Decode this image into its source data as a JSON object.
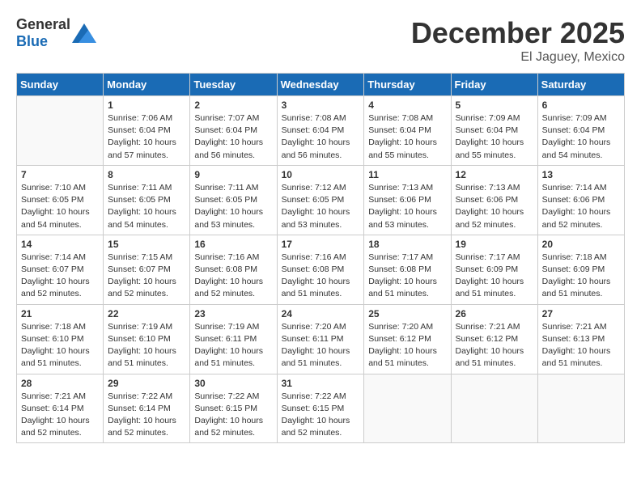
{
  "header": {
    "logo_general": "General",
    "logo_blue": "Blue",
    "month": "December 2025",
    "location": "El Jaguey, Mexico"
  },
  "days_of_week": [
    "Sunday",
    "Monday",
    "Tuesday",
    "Wednesday",
    "Thursday",
    "Friday",
    "Saturday"
  ],
  "weeks": [
    [
      {
        "day": "",
        "sunrise": "",
        "sunset": "",
        "daylight": ""
      },
      {
        "day": "1",
        "sunrise": "Sunrise: 7:06 AM",
        "sunset": "Sunset: 6:04 PM",
        "daylight": "Daylight: 10 hours and 57 minutes."
      },
      {
        "day": "2",
        "sunrise": "Sunrise: 7:07 AM",
        "sunset": "Sunset: 6:04 PM",
        "daylight": "Daylight: 10 hours and 56 minutes."
      },
      {
        "day": "3",
        "sunrise": "Sunrise: 7:08 AM",
        "sunset": "Sunset: 6:04 PM",
        "daylight": "Daylight: 10 hours and 56 minutes."
      },
      {
        "day": "4",
        "sunrise": "Sunrise: 7:08 AM",
        "sunset": "Sunset: 6:04 PM",
        "daylight": "Daylight: 10 hours and 55 minutes."
      },
      {
        "day": "5",
        "sunrise": "Sunrise: 7:09 AM",
        "sunset": "Sunset: 6:04 PM",
        "daylight": "Daylight: 10 hours and 55 minutes."
      },
      {
        "day": "6",
        "sunrise": "Sunrise: 7:09 AM",
        "sunset": "Sunset: 6:04 PM",
        "daylight": "Daylight: 10 hours and 54 minutes."
      }
    ],
    [
      {
        "day": "7",
        "sunrise": "Sunrise: 7:10 AM",
        "sunset": "Sunset: 6:05 PM",
        "daylight": "Daylight: 10 hours and 54 minutes."
      },
      {
        "day": "8",
        "sunrise": "Sunrise: 7:11 AM",
        "sunset": "Sunset: 6:05 PM",
        "daylight": "Daylight: 10 hours and 54 minutes."
      },
      {
        "day": "9",
        "sunrise": "Sunrise: 7:11 AM",
        "sunset": "Sunset: 6:05 PM",
        "daylight": "Daylight: 10 hours and 53 minutes."
      },
      {
        "day": "10",
        "sunrise": "Sunrise: 7:12 AM",
        "sunset": "Sunset: 6:05 PM",
        "daylight": "Daylight: 10 hours and 53 minutes."
      },
      {
        "day": "11",
        "sunrise": "Sunrise: 7:13 AM",
        "sunset": "Sunset: 6:06 PM",
        "daylight": "Daylight: 10 hours and 53 minutes."
      },
      {
        "day": "12",
        "sunrise": "Sunrise: 7:13 AM",
        "sunset": "Sunset: 6:06 PM",
        "daylight": "Daylight: 10 hours and 52 minutes."
      },
      {
        "day": "13",
        "sunrise": "Sunrise: 7:14 AM",
        "sunset": "Sunset: 6:06 PM",
        "daylight": "Daylight: 10 hours and 52 minutes."
      }
    ],
    [
      {
        "day": "14",
        "sunrise": "Sunrise: 7:14 AM",
        "sunset": "Sunset: 6:07 PM",
        "daylight": "Daylight: 10 hours and 52 minutes."
      },
      {
        "day": "15",
        "sunrise": "Sunrise: 7:15 AM",
        "sunset": "Sunset: 6:07 PM",
        "daylight": "Daylight: 10 hours and 52 minutes."
      },
      {
        "day": "16",
        "sunrise": "Sunrise: 7:16 AM",
        "sunset": "Sunset: 6:08 PM",
        "daylight": "Daylight: 10 hours and 52 minutes."
      },
      {
        "day": "17",
        "sunrise": "Sunrise: 7:16 AM",
        "sunset": "Sunset: 6:08 PM",
        "daylight": "Daylight: 10 hours and 51 minutes."
      },
      {
        "day": "18",
        "sunrise": "Sunrise: 7:17 AM",
        "sunset": "Sunset: 6:08 PM",
        "daylight": "Daylight: 10 hours and 51 minutes."
      },
      {
        "day": "19",
        "sunrise": "Sunrise: 7:17 AM",
        "sunset": "Sunset: 6:09 PM",
        "daylight": "Daylight: 10 hours and 51 minutes."
      },
      {
        "day": "20",
        "sunrise": "Sunrise: 7:18 AM",
        "sunset": "Sunset: 6:09 PM",
        "daylight": "Daylight: 10 hours and 51 minutes."
      }
    ],
    [
      {
        "day": "21",
        "sunrise": "Sunrise: 7:18 AM",
        "sunset": "Sunset: 6:10 PM",
        "daylight": "Daylight: 10 hours and 51 minutes."
      },
      {
        "day": "22",
        "sunrise": "Sunrise: 7:19 AM",
        "sunset": "Sunset: 6:10 PM",
        "daylight": "Daylight: 10 hours and 51 minutes."
      },
      {
        "day": "23",
        "sunrise": "Sunrise: 7:19 AM",
        "sunset": "Sunset: 6:11 PM",
        "daylight": "Daylight: 10 hours and 51 minutes."
      },
      {
        "day": "24",
        "sunrise": "Sunrise: 7:20 AM",
        "sunset": "Sunset: 6:11 PM",
        "daylight": "Daylight: 10 hours and 51 minutes."
      },
      {
        "day": "25",
        "sunrise": "Sunrise: 7:20 AM",
        "sunset": "Sunset: 6:12 PM",
        "daylight": "Daylight: 10 hours and 51 minutes."
      },
      {
        "day": "26",
        "sunrise": "Sunrise: 7:21 AM",
        "sunset": "Sunset: 6:12 PM",
        "daylight": "Daylight: 10 hours and 51 minutes."
      },
      {
        "day": "27",
        "sunrise": "Sunrise: 7:21 AM",
        "sunset": "Sunset: 6:13 PM",
        "daylight": "Daylight: 10 hours and 51 minutes."
      }
    ],
    [
      {
        "day": "28",
        "sunrise": "Sunrise: 7:21 AM",
        "sunset": "Sunset: 6:14 PM",
        "daylight": "Daylight: 10 hours and 52 minutes."
      },
      {
        "day": "29",
        "sunrise": "Sunrise: 7:22 AM",
        "sunset": "Sunset: 6:14 PM",
        "daylight": "Daylight: 10 hours and 52 minutes."
      },
      {
        "day": "30",
        "sunrise": "Sunrise: 7:22 AM",
        "sunset": "Sunset: 6:15 PM",
        "daylight": "Daylight: 10 hours and 52 minutes."
      },
      {
        "day": "31",
        "sunrise": "Sunrise: 7:22 AM",
        "sunset": "Sunset: 6:15 PM",
        "daylight": "Daylight: 10 hours and 52 minutes."
      },
      {
        "day": "",
        "sunrise": "",
        "sunset": "",
        "daylight": ""
      },
      {
        "day": "",
        "sunrise": "",
        "sunset": "",
        "daylight": ""
      },
      {
        "day": "",
        "sunrise": "",
        "sunset": "",
        "daylight": ""
      }
    ]
  ]
}
